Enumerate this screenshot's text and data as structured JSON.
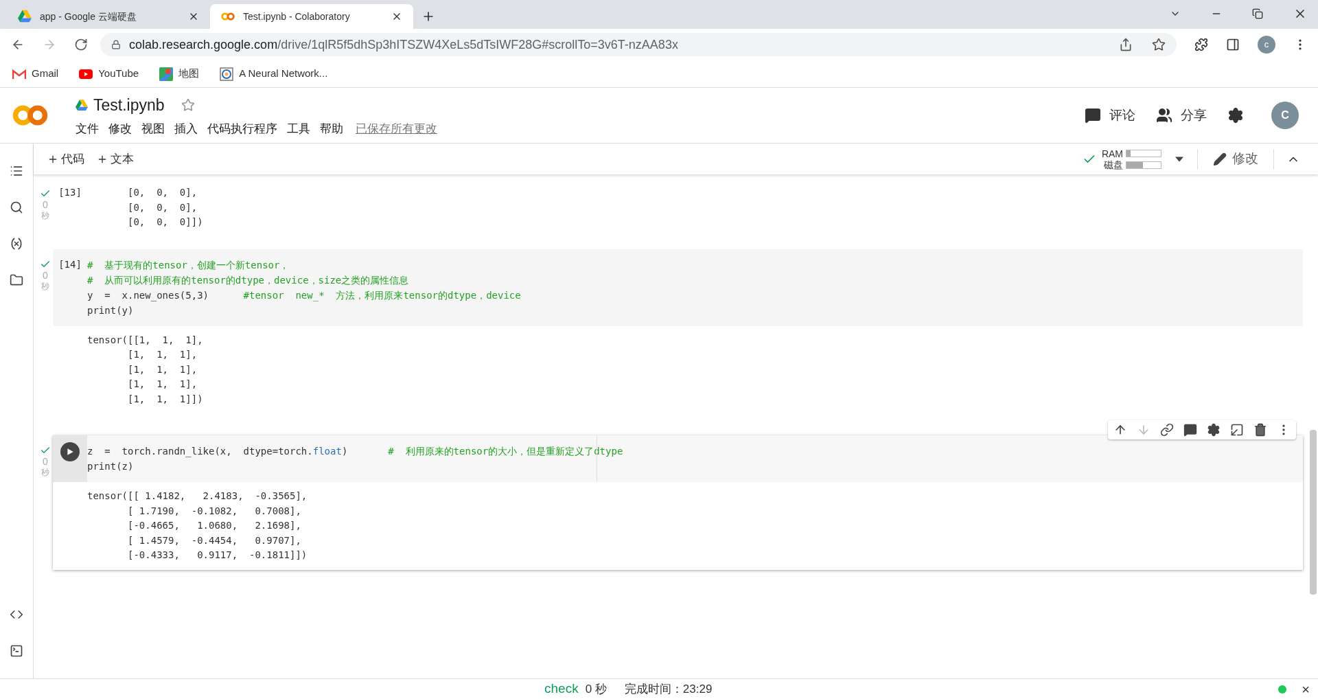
{
  "browser": {
    "tabs": [
      {
        "title": "app - Google 云端硬盘",
        "selected": false
      },
      {
        "title": "Test.ipynb - Colaboratory",
        "selected": true
      }
    ],
    "url_host": "colab.research.google.com",
    "url_path": "/drive/1qlR5f5dhSp3hITSZW4XeLs5dTsIWF28G#scrollTo=3v6T-nzAA83x",
    "profile": "c",
    "bookmarks": [
      {
        "label": "Gmail"
      },
      {
        "label": "YouTube"
      },
      {
        "label": "地图"
      },
      {
        "label": "A Neural Network..."
      }
    ]
  },
  "notebook": {
    "title": "Test.ipynb",
    "starred": false,
    "menu": [
      "文件",
      "修改",
      "视图",
      "插入",
      "代码执行程序",
      "工具",
      "帮助"
    ],
    "saved_status": "已保存所有更改",
    "actions": [
      {
        "label": "评论"
      },
      {
        "label": "分享"
      }
    ],
    "avatar": "C",
    "toolbar": [
      "代码",
      "文本"
    ],
    "resources": [
      {
        "label": "RAM",
        "level": 0.12
      },
      {
        "label": "磁盘",
        "level": 0.47
      }
    ],
    "edit_label": "修改"
  },
  "cells": [
    {
      "kind": "count",
      "count": "[13]",
      "time": "0",
      "unit": "秒",
      "focused": false,
      "output": [
        "       [0,  0,  0],",
        "       [0,  0,  0],",
        "       [0,  0,  0]])"
      ]
    },
    {
      "kind": "count",
      "count": "[14]",
      "time": "0",
      "unit": "秒",
      "focused": false,
      "code": [
        [
          {
            "kind": "comment",
            "text": "#  基于现有的tensor，创建一个新tensor，"
          }
        ],
        [
          {
            "kind": "comment",
            "text": "#  从而可以利用原有的tensor的dtype，device，size之类的属性信息"
          }
        ],
        [
          {
            "kind": "plain",
            "text": "y  =  x.new_ones(5,3)      "
          },
          {
            "kind": "comment",
            "text": "#tensor  new_*  方法，利用原来tensor的dtype，device"
          }
        ],
        [
          {
            "kind": "plain",
            "text": "print(y)"
          }
        ]
      ],
      "output": [
        "tensor([[1,  1,  1],",
        "       [1,  1,  1],",
        "       [1,  1,  1],",
        "       [1,  1,  1],",
        "       [1,  1,  1]])"
      ]
    },
    {
      "kind": "run",
      "time": "0",
      "unit": "秒",
      "focused": true,
      "code": [
        [
          {
            "kind": "plain",
            "text": "z  =  torch.randn_like(x,  dtype=torch."
          },
          {
            "kind": "attr",
            "text": "float"
          },
          {
            "kind": "plain",
            "text": ")       "
          },
          {
            "kind": "comment",
            "text": "#  利用原来的tensor的大小，但是重新定义了dtype"
          }
        ],
        [
          {
            "kind": "plain",
            "text": "print(z)"
          }
        ]
      ],
      "output": [
        "tensor([[ 1.4182,   2.4183,  -0.3565],",
        "       [ 1.7190,  -0.1082,   0.7008],",
        "       [-0.4665,   1.0680,   2.1698],",
        "       [ 1.4579,  -0.4454,   0.9707],",
        "       [-0.4333,   0.9117,  -0.1811]])"
      ]
    }
  ],
  "status_bar": {
    "check": "check",
    "duration": "0 秒",
    "finished": "完成时间：23:29",
    "connected": true,
    "close": "×"
  }
}
